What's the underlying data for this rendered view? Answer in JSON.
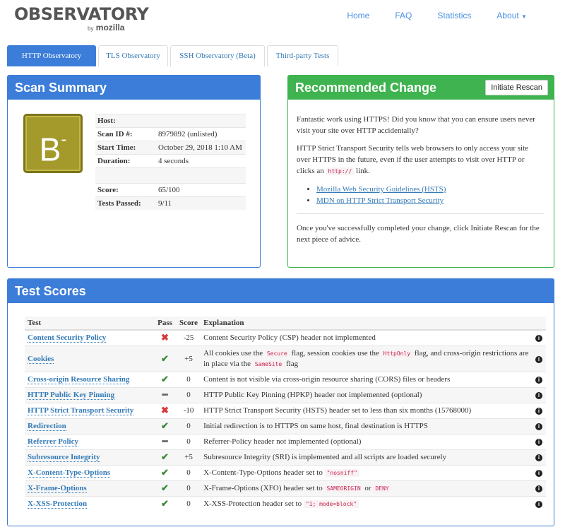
{
  "header": {
    "logo_main": "OBSERVATORY",
    "logo_by": "by",
    "logo_sub": "mozilla",
    "nav": [
      "Home",
      "FAQ",
      "Statistics",
      "About"
    ]
  },
  "tabs": [
    "HTTP Observatory",
    "TLS Observatory",
    "SSH Observatory (Beta)",
    "Third-party Tests"
  ],
  "summary": {
    "title": "Scan Summary",
    "grade": "B",
    "grade_mod": "-",
    "rows": [
      {
        "k": "Host:",
        "v": ""
      },
      {
        "k": "Scan ID #:",
        "v": "8979892 (unlisted)"
      },
      {
        "k": "Start Time:",
        "v": "October 29, 2018 1:10 AM"
      },
      {
        "k": "Duration:",
        "v": "4 seconds"
      },
      {
        "k": "",
        "v": ""
      },
      {
        "k": "Score:",
        "v": "65/100"
      },
      {
        "k": "Tests Passed:",
        "v": "9/11"
      }
    ]
  },
  "recommend": {
    "title": "Recommended Change",
    "rescan": "Initiate Rescan",
    "p1": "Fantastic work using HTTPS! Did you know that you can ensure users never visit your site over HTTP accidentally?",
    "p2a": "HTTP Strict Transport Security tells web browsers to only access your site over HTTPS in the future, even if the user attempts to visit over HTTP or clicks an",
    "p2code": "http://",
    "p2b": "link.",
    "links": [
      "Mozilla Web Security Guidelines (HSTS)",
      "MDN on HTTP Strict Transport Security"
    ],
    "p3": "Once you've successfully completed your change, click Initiate Rescan for the next piece of advice."
  },
  "tests": {
    "title": "Test Scores",
    "headers": [
      "Test",
      "Pass",
      "Score",
      "Explanation"
    ],
    "rows": [
      {
        "name": "Content Security Policy",
        "pass": "x",
        "score": "-25",
        "exp": [
          {
            "t": "Content Security Policy (CSP) header not implemented"
          }
        ]
      },
      {
        "name": "Cookies",
        "pass": "check",
        "score": "+5",
        "exp": [
          {
            "t": "All cookies use the "
          },
          {
            "c": "Secure"
          },
          {
            "t": " flag, session cookies use the "
          },
          {
            "c": "HttpOnly"
          },
          {
            "t": " flag, and cross-origin restrictions are in place via the "
          },
          {
            "c": "SameSite"
          },
          {
            "t": " flag"
          }
        ]
      },
      {
        "name": "Cross-origin Resource Sharing",
        "pass": "check",
        "score": "0",
        "exp": [
          {
            "t": "Content is not visible via cross-origin resource sharing (CORS) files or headers"
          }
        ]
      },
      {
        "name": "HTTP Public Key Pinning",
        "pass": "dash",
        "score": "0",
        "exp": [
          {
            "t": "HTTP Public Key Pinning (HPKP) header not implemented (optional)"
          }
        ]
      },
      {
        "name": "HTTP Strict Transport Security",
        "pass": "x",
        "score": "-10",
        "exp": [
          {
            "t": "HTTP Strict Transport Security (HSTS) header set to less than six months (15768000)"
          }
        ]
      },
      {
        "name": "Redirection",
        "pass": "check",
        "score": "0",
        "exp": [
          {
            "t": "Initial redirection is to HTTPS on same host, final destination is HTTPS"
          }
        ]
      },
      {
        "name": "Referrer Policy",
        "pass": "dash",
        "score": "0",
        "exp": [
          {
            "t": "Referrer-Policy header not implemented (optional)"
          }
        ]
      },
      {
        "name": "Subresource Integrity",
        "pass": "check",
        "score": "+5",
        "exp": [
          {
            "t": "Subresource Integrity (SRI) is implemented and all scripts are loaded securely"
          }
        ]
      },
      {
        "name": "X-Content-Type-Options",
        "pass": "check",
        "score": "0",
        "exp": [
          {
            "t": "X-Content-Type-Options header set to "
          },
          {
            "c": "\"nosniff\""
          }
        ]
      },
      {
        "name": "X-Frame-Options",
        "pass": "check",
        "score": "0",
        "exp": [
          {
            "t": "X-Frame-Options (XFO) header set to "
          },
          {
            "c": "SAMEORIGIN"
          },
          {
            "t": " or "
          },
          {
            "c": "DENY"
          }
        ]
      },
      {
        "name": "X-XSS-Protection",
        "pass": "check",
        "score": "0",
        "exp": [
          {
            "t": "X-XSS-Protection header set to "
          },
          {
            "c": "\"1; mode=block\""
          }
        ]
      }
    ]
  }
}
